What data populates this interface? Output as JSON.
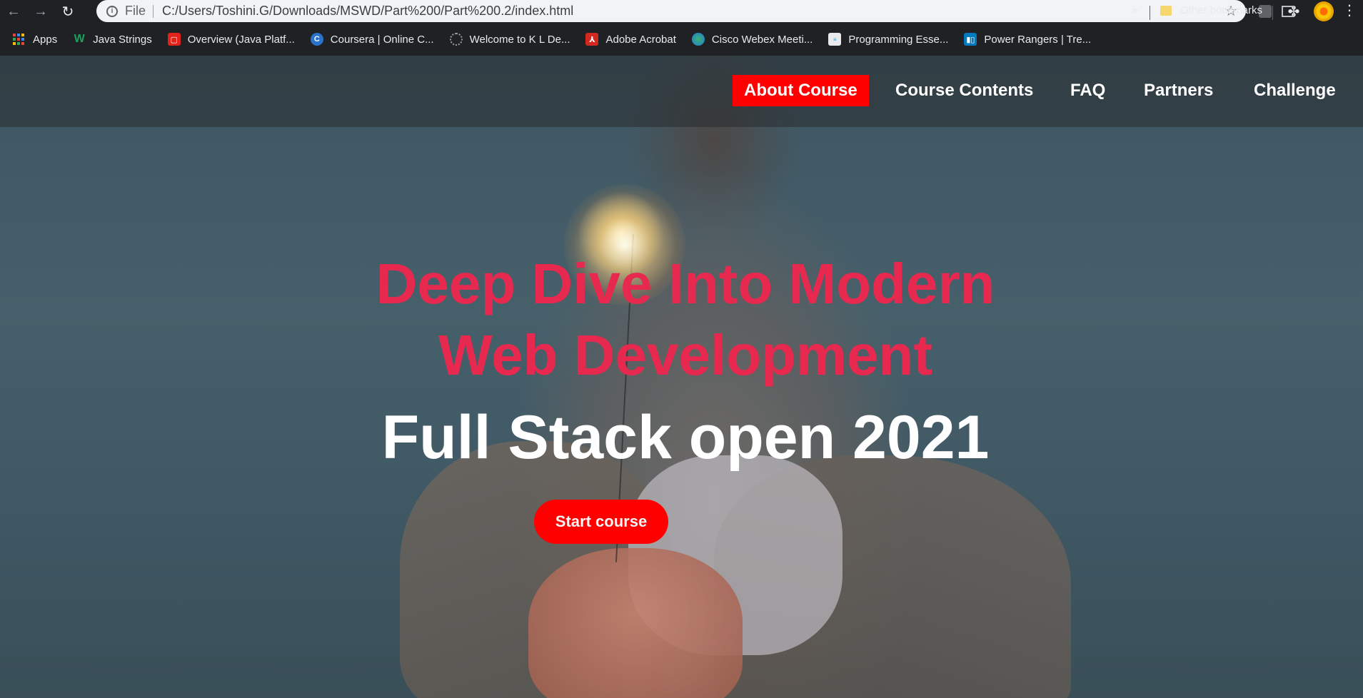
{
  "browser": {
    "scheme_label": "File",
    "url": "C:/Users/Toshini.G/Downloads/MSWD/Part%200/Part%200.2/index.html",
    "bookmarks": [
      {
        "label": "Apps",
        "icon": "apps-grid-icon"
      },
      {
        "label": "Java Strings",
        "icon": "w-logo-icon",
        "color": "#1aa260"
      },
      {
        "label": "Overview (Java Platf...",
        "icon": "oracle-icon",
        "color": "#e2231a"
      },
      {
        "label": "Coursera | Online C...",
        "icon": "coursera-icon",
        "color": "#2a73cc"
      },
      {
        "label": "Welcome to K L De...",
        "icon": "loading-icon",
        "color": "#5f6368"
      },
      {
        "label": "Adobe Acrobat",
        "icon": "acrobat-icon",
        "color": "#d3281f"
      },
      {
        "label": "Cisco Webex Meeti...",
        "icon": "webex-icon",
        "color": "#3bb273"
      },
      {
        "label": "Programming Esse...",
        "icon": "cisco-icon",
        "color": "#1ba0d7"
      },
      {
        "label": "Power Rangers | Tre...",
        "icon": "trello-icon",
        "color": "#0079bf"
      }
    ],
    "more_label": "»",
    "other_bookmarks": "Other bookmarks"
  },
  "nav": {
    "items": [
      {
        "label": "About Course",
        "active": true
      },
      {
        "label": "Course Contents",
        "active": false
      },
      {
        "label": "FAQ",
        "active": false
      },
      {
        "label": "Partners",
        "active": false
      },
      {
        "label": "Challenge",
        "active": false
      }
    ],
    "accent": "#ff0000"
  },
  "hero": {
    "title_line1": "Deep Dive Into Modern",
    "title_line2": "Web Development",
    "subtitle": "Full Stack open 2021",
    "title_color": "#e8294f",
    "cta": "Start course"
  }
}
